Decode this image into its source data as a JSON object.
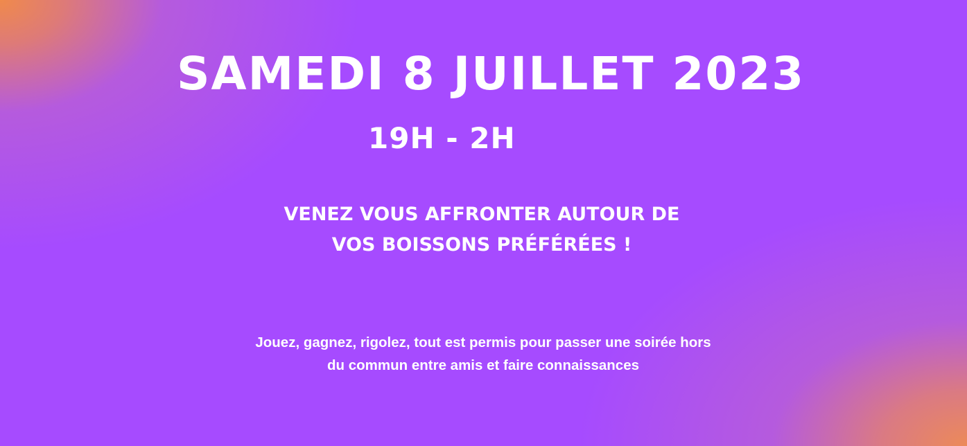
{
  "event": {
    "date": "SAMEDI 8 JUILLET 2023",
    "hours": "19H - 2H"
  },
  "tagline": {
    "line1": "VENEZ VOUS AFFRONTER AUTOUR DE",
    "line2": "VOS BOISSONS PRÉFÉRÉES !"
  },
  "description": {
    "line1": "Jouez, gagnez, rigolez, tout est permis pour passer une soirée hors",
    "line2": "du commun entre amis et faire connaissances"
  },
  "colors": {
    "background_primary": "#a64bff",
    "gradient_corner_accent": "#f08a4b",
    "text": "#ffffff"
  }
}
